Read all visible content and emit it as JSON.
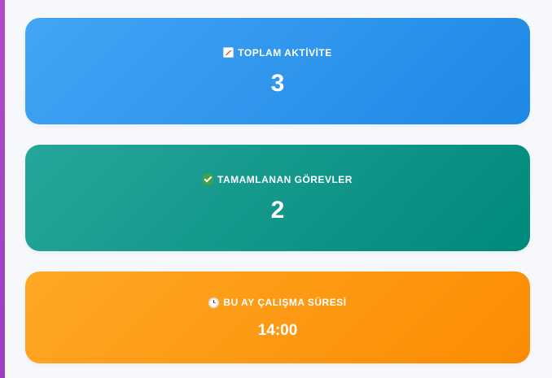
{
  "cards": [
    {
      "icon": "chart-increasing-icon",
      "label": "TOPLAM AKTİVİTE",
      "value": "3",
      "color": "#2196f3"
    },
    {
      "icon": "check-mark-icon",
      "label": "TAMAMLANAN GÖREVLER",
      "value": "2",
      "color": "#009688"
    },
    {
      "icon": "stopwatch-icon",
      "label": "BU AY ÇALIŞMA SÜRESİ",
      "value": "14:00",
      "color": "#ff9800"
    }
  ]
}
